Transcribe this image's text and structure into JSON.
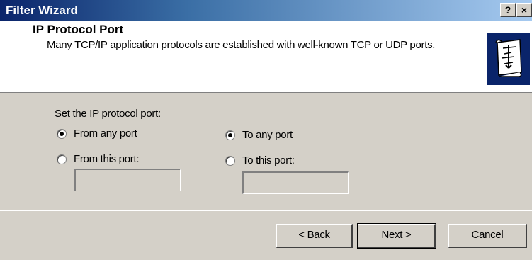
{
  "window": {
    "title": "Filter Wizard",
    "help_label": "?",
    "close_label": "×"
  },
  "header": {
    "title": "IP Protocol Port",
    "description": "Many TCP/IP application protocols are established with well-known TCP or UDP ports."
  },
  "form": {
    "section_label": "Set the IP protocol port:",
    "from_any_label": "From any port",
    "from_this_label": "From this port:",
    "to_any_label": "To any port",
    "to_this_label": "To this port:",
    "from_port_value": "",
    "to_port_value": "",
    "from_selected": "from_any",
    "to_selected": "to_any"
  },
  "buttons": {
    "back": "< Back",
    "next": "Next >",
    "cancel": "Cancel"
  },
  "colors": {
    "titlebar_start": "#0a246a",
    "titlebar_end": "#a6caf0",
    "dialog_bg": "#d4d0c8"
  },
  "icons": {
    "wizard": "wizard-scroll-icon"
  }
}
